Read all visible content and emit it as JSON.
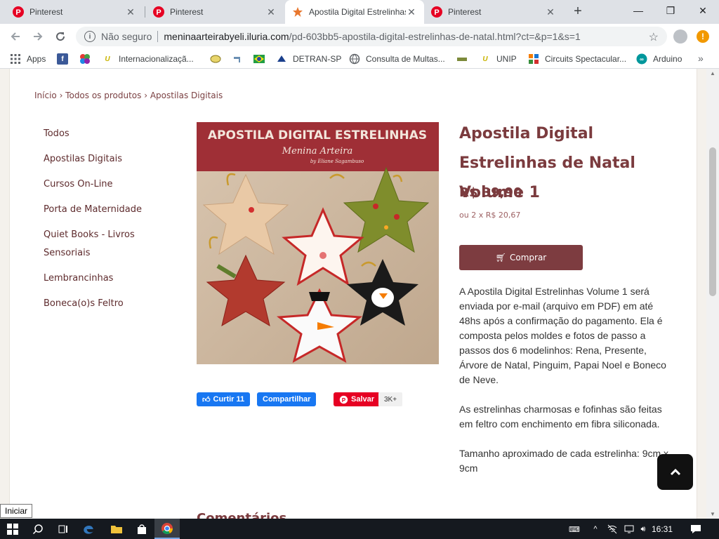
{
  "browser": {
    "tabs": [
      {
        "label": "Pinterest",
        "icon": "pinterest-icon",
        "active": false
      },
      {
        "label": "Pinterest",
        "icon": "pinterest-icon",
        "active": false
      },
      {
        "label": "Apostila Digital Estrelinhas",
        "icon": "iluria-icon",
        "active": true
      },
      {
        "label": "Pinterest",
        "icon": "pinterest-icon",
        "active": false
      }
    ],
    "new_tab": "+",
    "window_controls": {
      "minimize": "—",
      "maximize": "❐",
      "close": "✕"
    },
    "security_label": "Não seguro",
    "url_domain": "meninaarteirabyeli.iluria.com",
    "url_path": "/pd-603bb5-apostila-digital-estrelinhas-de-natal.html?ct=&p=1&s=1",
    "bookmarks": [
      {
        "label": "Apps",
        "icon": "apps-grid-icon"
      },
      {
        "label": "",
        "icon": "facebook-icon"
      },
      {
        "label": "",
        "icon": "colorful-wheel-icon"
      },
      {
        "label": "Internacionalizaçã...",
        "icon": "unip-logo-icon"
      },
      {
        "label": "",
        "icon": "smile-icon"
      },
      {
        "label": "",
        "icon": "faucet-icon"
      },
      {
        "label": "",
        "icon": "brazil-flag-icon"
      },
      {
        "label": "DETRAN-SP",
        "icon": "detran-icon"
      },
      {
        "label": "Consulta de Multas...",
        "icon": "globe-icon"
      },
      {
        "label": "",
        "icon": "car-icon"
      },
      {
        "label": "UNIP",
        "icon": "unip-logo-icon"
      },
      {
        "label": "Circuits Spectacular...",
        "icon": "circuits-icon"
      },
      {
        "label": "Arduino",
        "icon": "arduino-icon"
      }
    ],
    "bookmarks_more": "»"
  },
  "page": {
    "breadcrumb": "Início › Todos os produtos › Apostilas Digitais",
    "categories": [
      "Todos",
      "Apostilas Digitais",
      "Cursos On-Line",
      "Porta de Maternidade",
      "Quiet Books - Livros Sensoriais",
      "Lembrancinhas",
      "Boneca(o)s Feltro"
    ],
    "product": {
      "image_title": "APOSTILA DIGITAL ESTRELINHAS",
      "image_brand": "Menina Arteira",
      "image_credit": "by Eliane Sagambuso",
      "title": "Apostila Digital Estrelinhas de Natal Volume 1",
      "price": "R$ 39,90",
      "installments": "ou 2 x R$ 20,67",
      "buy_label": "Comprar",
      "description": [
        "A Apostila Digital Estrelinhas Volume 1 será enviada por e-mail (arquivo em PDF) em até 48hs após a confirmação do pagamento. Ela é composta pelos moldes e fotos de passo a passos dos 6 modelinhos: Rena, Presente, Árvore de Natal, Pinguim, Papai Noel e Boneco de Neve.",
        "As estrelinhas charmosas e fofinhas são feitas em feltro com enchimento em fibra siliconada.",
        "Tamanho aproximado de cada estrelinha: 9cm x 9cm"
      ]
    },
    "social": {
      "like_label": "Curtir 11",
      "share_label": "Compartilhar",
      "pin_label": "Salvar",
      "pin_count": "3K+"
    },
    "comments_heading": "Comentários"
  },
  "tooltip": "Iniciar",
  "taskbar": {
    "time": "16:31"
  },
  "colors": {
    "brand": "#7b3b3e",
    "buy_button": "#7d3c40",
    "facebook": "#1877f2",
    "pinterest": "#e60023"
  }
}
